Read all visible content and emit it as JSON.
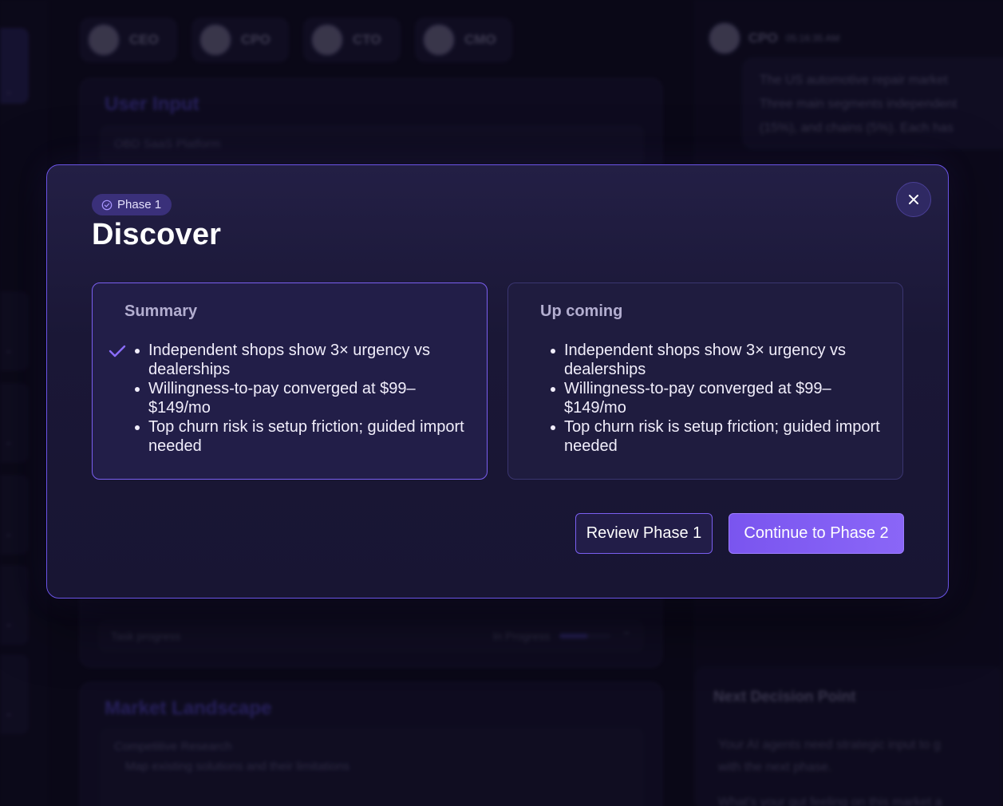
{
  "background": {
    "agents": [
      "CEO",
      "CPO",
      "CTO",
      "CMO"
    ],
    "user_input_title": "User Input",
    "user_input_value": "OBD SaaS Platform",
    "task_progress_label": "Task progress",
    "task_progress_state": "In Progress",
    "task_progress_fraction": 0.55,
    "market_title": "Market Landscape",
    "market_input_label": "Competitive Research",
    "market_bullet": "Map existing solutions and their limitations",
    "chat_author": "CPO",
    "chat_time": "05:16:35 AM",
    "chat_lines": [
      "The US automotive repair market",
      "Three main segments independent",
      "(15%), and chains (5%). Each has"
    ],
    "next_decision_title": "Next Decision Point",
    "next_decision_lines": [
      "Your AI agents need strategic input to g",
      "with the next phase.",
      "",
      "What's your gut feeling on this market a"
    ]
  },
  "modal": {
    "phase_badge": "Phase 1",
    "title": "Discover",
    "summary": {
      "title": "Summary",
      "items": [
        "Independent shops show 3× urgency vs dealerships",
        "Willingness-to-pay converged at $99–$149/mo",
        "Top churn risk is setup friction; guided import needed"
      ]
    },
    "upcoming": {
      "title": "Up coming",
      "items": [
        "Independent shops show 3× urgency vs dealerships",
        "Willingness-to-pay converged at $99–$149/mo",
        "Top churn risk is setup friction; guided import needed"
      ]
    },
    "review_button": "Review Phase 1",
    "continue_button": "Continue to Phase 2"
  },
  "colors": {
    "accent": "#7a5ff0",
    "modal_bg": "#1a1736",
    "page_bg": "#0c0a1a"
  },
  "icons": [
    "check-circle-icon",
    "close-icon",
    "checkmark-icon",
    "chevron-up-icon",
    "chevron-down-icon"
  ]
}
